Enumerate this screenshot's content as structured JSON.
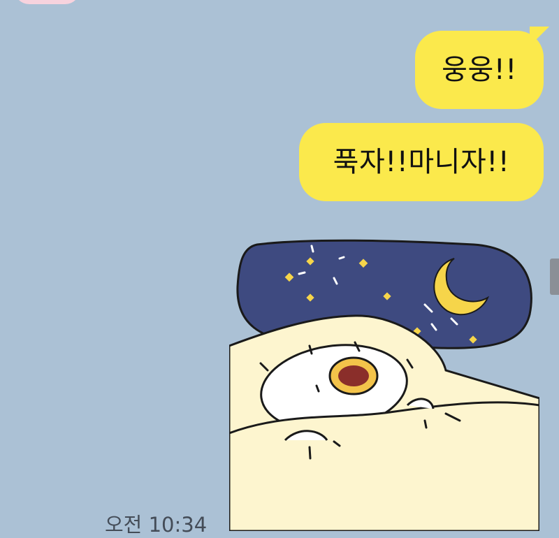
{
  "chat": {
    "messages": [
      {
        "text": "웅웅!!"
      },
      {
        "text": "푹자!!마니자!!"
      }
    ],
    "sticker": {
      "name": "sleeping-chick-sticker"
    },
    "timestamp": "오전 10:34"
  },
  "colors": {
    "background": "#abc1d5",
    "my_bubble": "#fbe94c",
    "night_sky": "#3e4a80",
    "moon": "#f6d54a",
    "blanket": "#fdf5cf"
  }
}
